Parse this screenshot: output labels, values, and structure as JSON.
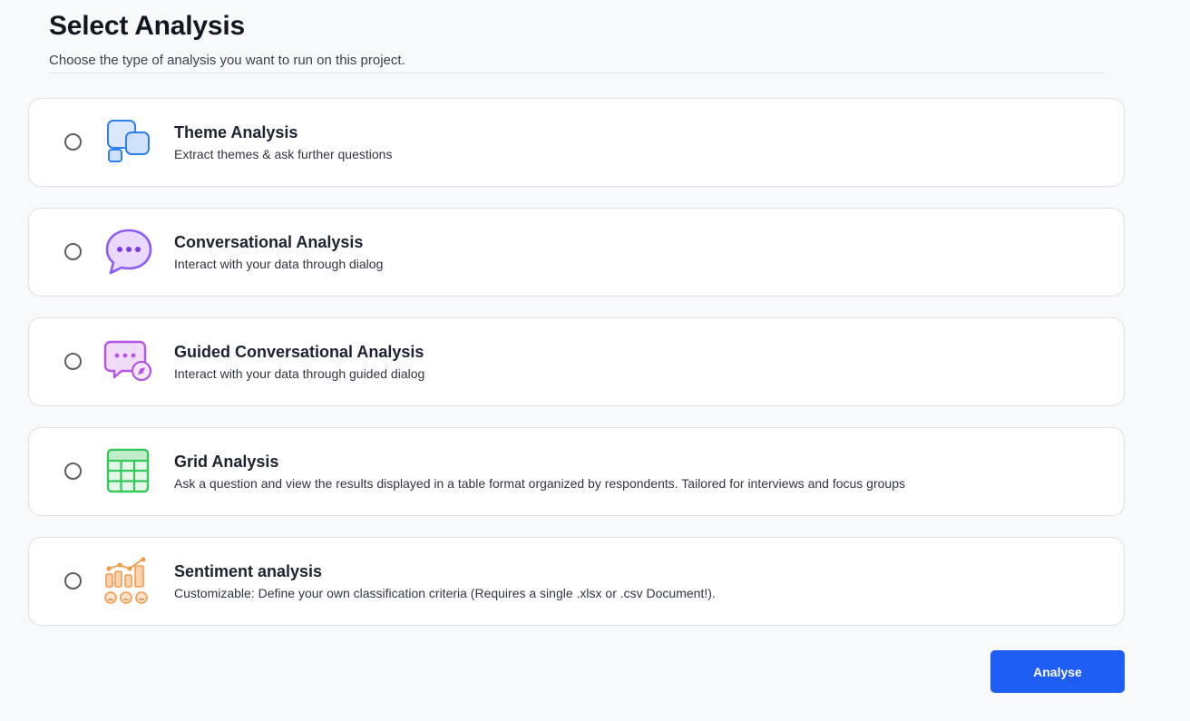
{
  "header": {
    "title": "Select Analysis",
    "subtitle": "Choose the type of analysis you want to run on this project."
  },
  "options": [
    {
      "title": "Theme Analysis",
      "description": "Extract themes & ask further questions",
      "icon": "theme-squares-icon",
      "selected": false,
      "accent": "#2f80ed"
    },
    {
      "title": "Conversational Analysis",
      "description": "Interact with your data through dialog",
      "icon": "chat-bubble-icon",
      "selected": false,
      "accent": "#8b5cf6"
    },
    {
      "title": "Guided Conversational Analysis",
      "description": "Interact with your data through guided dialog",
      "icon": "guided-chat-icon",
      "selected": false,
      "accent": "#b455e6"
    },
    {
      "title": "Grid Analysis",
      "description": "Ask a question and view the results displayed in a table format organized by respondents. Tailored for interviews and focus groups",
      "icon": "grid-table-icon",
      "selected": false,
      "accent": "#34c759"
    },
    {
      "title": "Sentiment analysis",
      "description": "Customizable: Define your own classification criteria (Requires a single .xlsx or .csv Document!).",
      "icon": "sentiment-chart-icon",
      "selected": false,
      "accent": "#f39a4f"
    }
  ],
  "actions": {
    "analyse_label": "Analyse",
    "primary_color": "#1f5ef5"
  }
}
